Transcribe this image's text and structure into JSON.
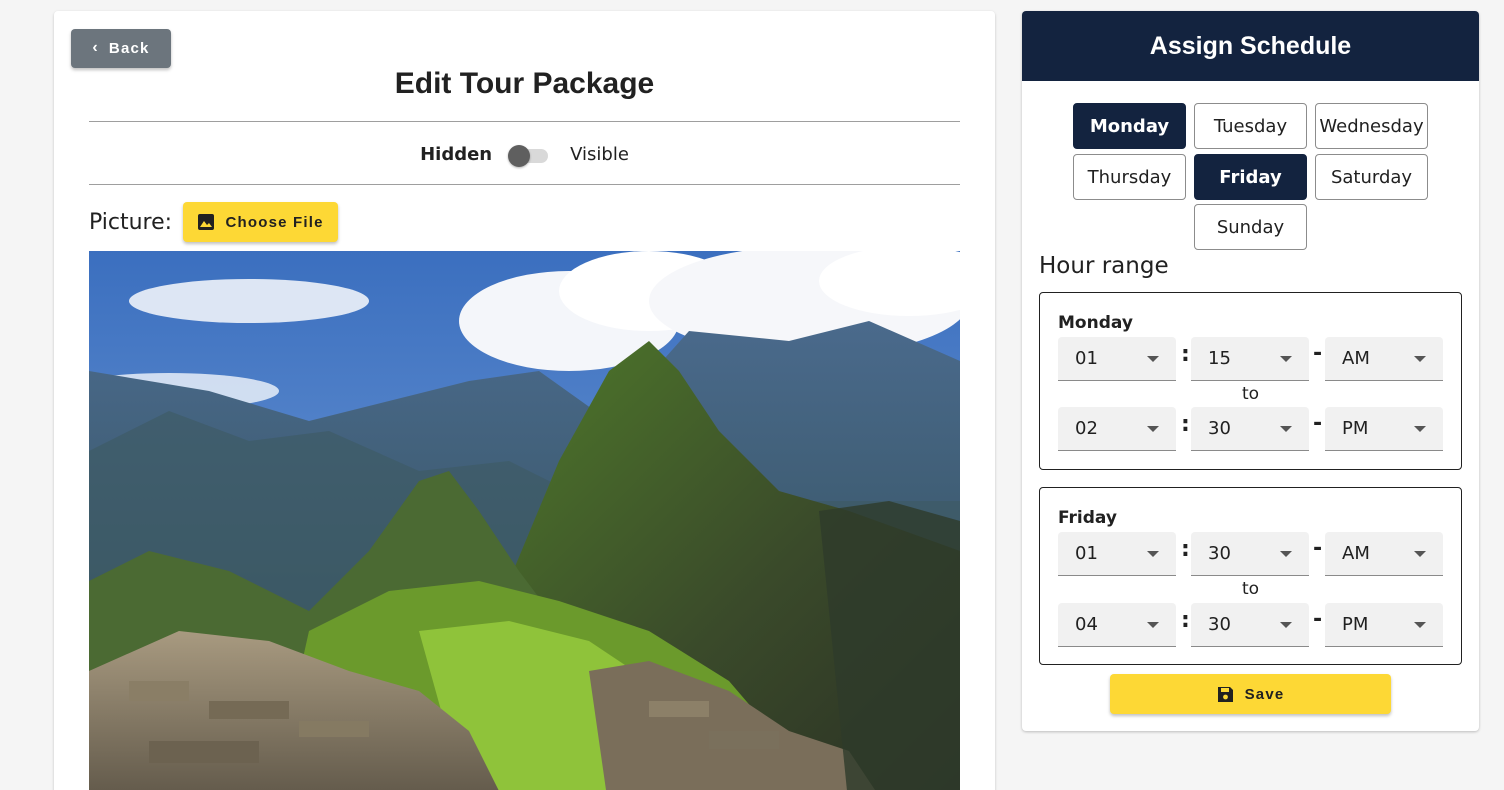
{
  "edit_panel": {
    "back_label": "Back",
    "title": "Edit Tour Package",
    "visibility": {
      "hidden_label": "Hidden",
      "visible_label": "Visible",
      "is_visible": false
    },
    "picture_label": "Picture:",
    "choose_file_label": "Choose File",
    "icons": {
      "back": "chevron-left-icon",
      "choose_file": "image-icon"
    }
  },
  "schedule_panel": {
    "title": "Assign Schedule",
    "days": [
      {
        "label": "Monday",
        "selected": true
      },
      {
        "label": "Tuesday",
        "selected": false
      },
      {
        "label": "Wednesday",
        "selected": false
      },
      {
        "label": "Thursday",
        "selected": false
      },
      {
        "label": "Friday",
        "selected": true
      },
      {
        "label": "Saturday",
        "selected": false
      },
      {
        "label": "Sunday",
        "selected": false
      }
    ],
    "hour_range_title": "Hour range",
    "ranges": [
      {
        "day": "Monday",
        "start": {
          "hour": "01",
          "minute": "15",
          "period": "AM"
        },
        "to_label": "to",
        "end": {
          "hour": "02",
          "minute": "30",
          "period": "PM"
        }
      },
      {
        "day": "Friday",
        "start": {
          "hour": "01",
          "minute": "30",
          "period": "AM"
        },
        "to_label": "to",
        "end": {
          "hour": "04",
          "minute": "30",
          "period": "PM"
        }
      }
    ],
    "save_label": "Save",
    "icons": {
      "save": "floppy-disk-icon"
    }
  },
  "colors": {
    "navy": "#13233f",
    "accent_yellow": "#fdd835",
    "back_gray": "#6c757d"
  }
}
